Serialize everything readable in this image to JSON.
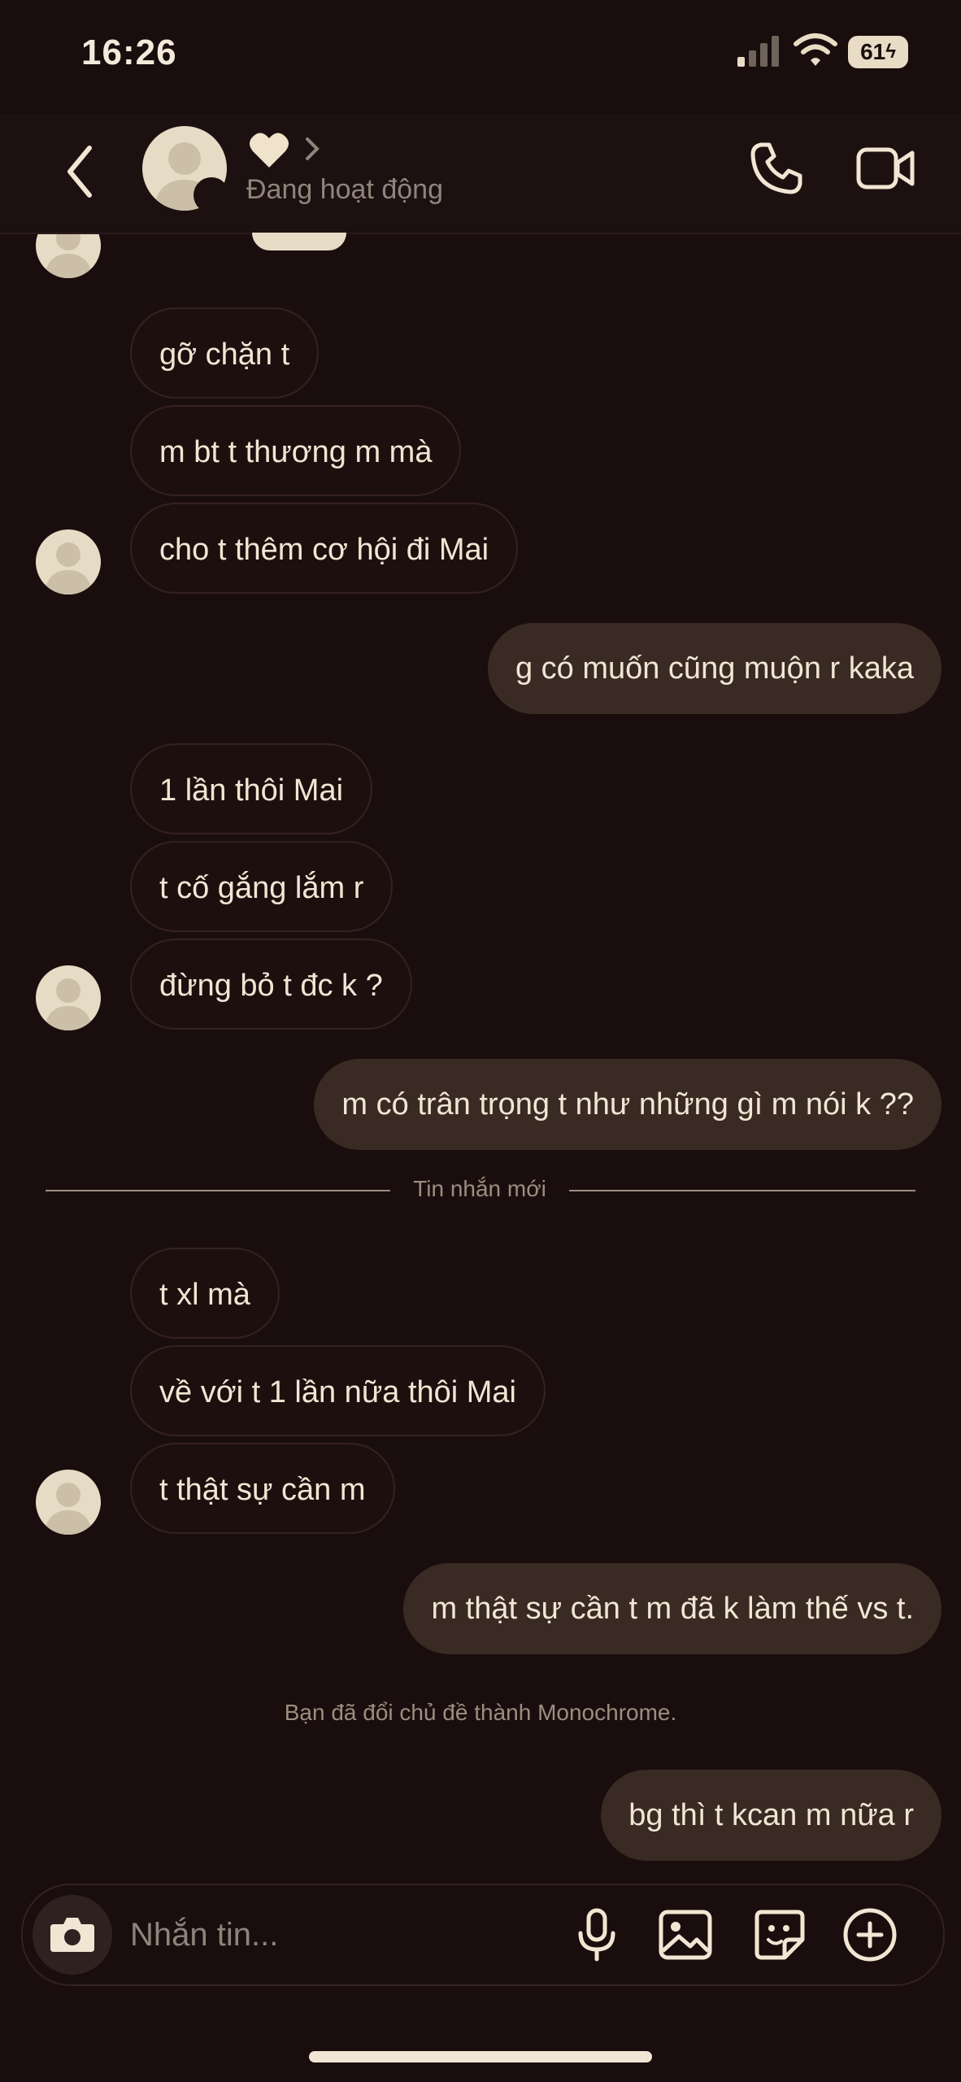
{
  "status_bar": {
    "time": "16:26",
    "battery": "61"
  },
  "header": {
    "contact_name_icon": "heart-icon",
    "status": "Đang hoạt động",
    "back_icon": "chevron-left-icon",
    "call_icon": "phone-icon",
    "video_icon": "video-camera-icon"
  },
  "messages": [
    {
      "dir": "in",
      "text": "gỡ chặn t"
    },
    {
      "dir": "in",
      "text": "m bt t thương m mà"
    },
    {
      "dir": "in",
      "text": "cho t thêm cơ hội đi Mai"
    },
    {
      "dir": "out",
      "text": "g có muốn cũng muộn r kaka"
    },
    {
      "dir": "in",
      "text": "1 lần thôi Mai"
    },
    {
      "dir": "in",
      "text": "t cố gắng lắm r"
    },
    {
      "dir": "in",
      "text": "đừng bỏ t đc k ?"
    },
    {
      "dir": "out",
      "text": "m có trân trọng t như những gì m nói k ??"
    },
    {
      "dir": "in",
      "text": "t xl mà"
    },
    {
      "dir": "in",
      "text": "về với t 1 lần nữa thôi Mai"
    },
    {
      "dir": "in",
      "text": "t thật sự cần m"
    },
    {
      "dir": "out",
      "text": "m thật sự cần t m đã k làm thế vs t."
    },
    {
      "dir": "out",
      "text": "bg thì t kcan m nữa r"
    }
  ],
  "divider_label": "Tin nhắn mới",
  "system_message": "Bạn đã đổi chủ đề thành Monochrome.",
  "composer": {
    "placeholder": "Nhắn tin...",
    "icons": [
      "camera-icon",
      "microphone-icon",
      "image-icon",
      "sticker-icon",
      "plus-icon"
    ]
  },
  "colors": {
    "background": "#1a0d0d",
    "incoming_bubble": "#1e0f0f",
    "outgoing_bubble": "#3a2a24",
    "text": "#f1e6d3"
  }
}
